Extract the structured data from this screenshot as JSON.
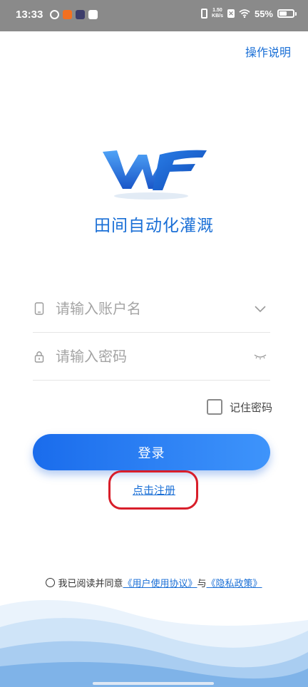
{
  "status_bar": {
    "time": "13:33",
    "net_speed_value": "1.50",
    "net_speed_unit": "KB/s",
    "battery": "55%",
    "battery_level": 0.55
  },
  "header": {
    "help_label": "操作说明"
  },
  "app": {
    "title": "田间自动化灌溉"
  },
  "form": {
    "account_placeholder": "请输入账户名",
    "password_placeholder": "请输入密码",
    "remember_label": "记住密码",
    "remember_checked": false
  },
  "actions": {
    "login_label": "登录",
    "register_label": "点击注册"
  },
  "agreement": {
    "prefix": "我已阅读并同意",
    "user_agreement": "《用户使用协议》",
    "connector": "与",
    "privacy_policy": "《隐私政策》",
    "checked": false
  },
  "colors": {
    "accent": "#1a6fd6",
    "button_start": "#1a6cec",
    "button_end": "#3e94fb",
    "highlight": "#d81e2a",
    "status_bar": "#8a8a8a"
  },
  "icons": [
    "phone-icon",
    "lock-icon",
    "chevron-down-icon",
    "eye-closed-icon",
    "wifi-icon",
    "battery-icon"
  ]
}
